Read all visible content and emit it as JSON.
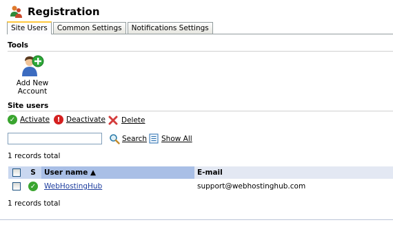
{
  "page": {
    "title": "Registration"
  },
  "tabs": [
    {
      "label": "Site Users",
      "active": true
    },
    {
      "label": "Common Settings",
      "active": false
    },
    {
      "label": "Notifications Settings",
      "active": false
    }
  ],
  "tools": {
    "heading": "Tools",
    "add_account_label_line1": "Add New",
    "add_account_label_line2": "Account"
  },
  "site_users": {
    "heading": "Site users",
    "actions": {
      "activate": "Activate",
      "deactivate": "Deactivate",
      "delete": "Delete"
    },
    "search": {
      "value": "",
      "placeholder": "",
      "button_label": "Search",
      "show_all_label": "Show All"
    },
    "records_top": "1  records total",
    "records_bottom": "1  records total"
  },
  "grid": {
    "columns": {
      "s": "S",
      "username": "User name ▲",
      "email": "E-mail"
    },
    "rows": [
      {
        "username": "WebHostingHub",
        "email": "support@webhostinghub.com",
        "status": "active"
      }
    ]
  },
  "colors": {
    "active_tab_accent": "#ffc83c",
    "status_active": "#3aa52f",
    "deactivate": "#d42020",
    "delete": "#d43c3c",
    "header_sorted": "#a9bfe6"
  }
}
